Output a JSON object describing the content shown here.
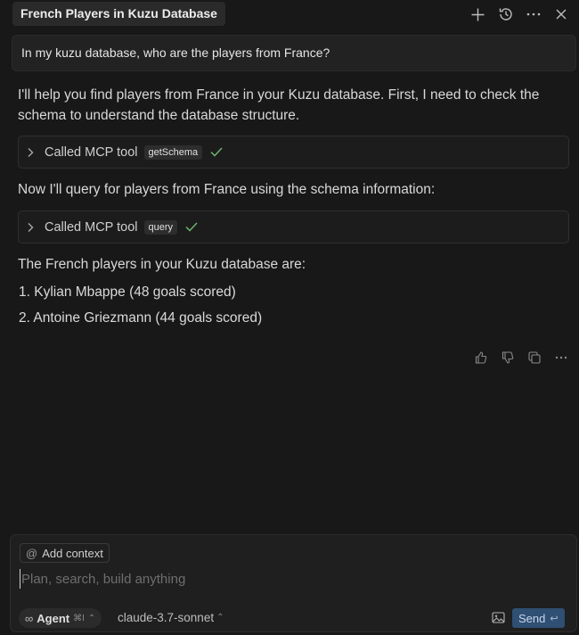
{
  "header": {
    "title": "French Players in Kuzu Database",
    "icons": [
      "plus-icon",
      "history-icon",
      "more-icon",
      "close-icon"
    ]
  },
  "user_message": "In my kuzu database, who are the players from France?",
  "assistant": {
    "intro": "I'll help you find players from France in your Kuzu database. First, I need to check the schema to understand the database structure.",
    "tool1": {
      "label": "Called MCP tool",
      "tag": "getSchema"
    },
    "middle": "Now I'll query for players from France using the schema information:",
    "tool2": {
      "label": "Called MCP tool",
      "tag": "query"
    },
    "results_intro": "The French players in your Kuzu database are:",
    "results": [
      "1. Kylian Mbappe (48 goals scored)",
      "2. Antoine Griezmann (44 goals scored)"
    ],
    "action_icons": [
      "thumbs-up-icon",
      "thumbs-down-icon",
      "copy-icon",
      "more-icon"
    ]
  },
  "composer": {
    "add_context": "Add context",
    "at_symbol": "@",
    "placeholder": "Plan, search, build anything",
    "agent_icon": "∞",
    "agent_label": "Agent",
    "agent_shortcut": "⌘I",
    "model": "claude-3.7-sonnet",
    "send_label": "Send",
    "send_key": "↩"
  },
  "colors": {
    "background": "#181818",
    "send_button": "#2f4f73",
    "check": "#6bb36b"
  }
}
